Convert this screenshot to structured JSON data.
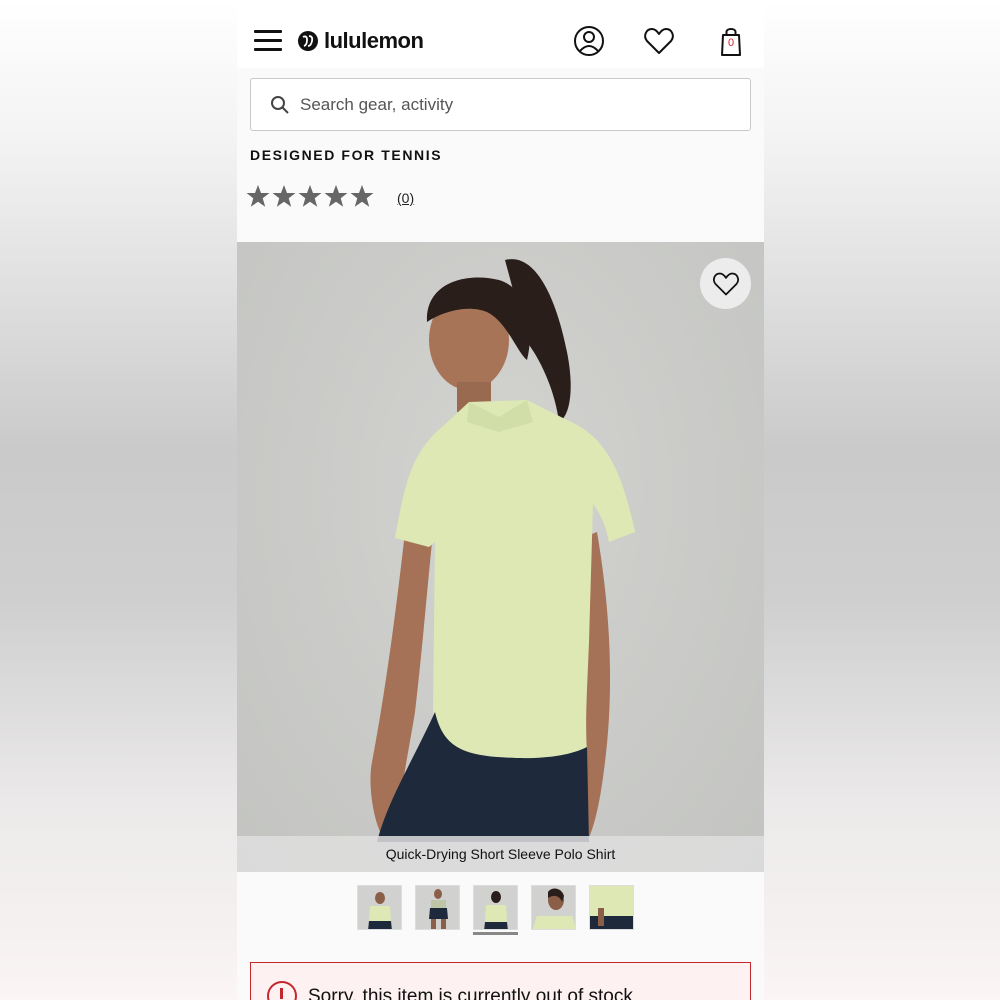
{
  "header": {
    "brand": "lululemon",
    "menu_icon": "hamburger-icon",
    "account_icon": "account-icon",
    "wishlist_icon": "heart-icon",
    "bag_icon": "shopping-bag-icon",
    "bag_count": "0"
  },
  "search": {
    "placeholder": "Search gear, activity"
  },
  "product": {
    "tagline": "DESIGNED FOR TENNIS",
    "rating_stars": 5,
    "review_count": "(0)",
    "image_caption": "Quick-Drying Short Sleeve Polo Shirt",
    "thumbnails_count": 5,
    "active_thumbnail": 3
  },
  "alert": {
    "message": "Sorry, this item is currently out of stock"
  },
  "colors": {
    "accent_red": "#c4262e",
    "shirt": "#dde8b4",
    "skirt": "#1e2a3c"
  }
}
